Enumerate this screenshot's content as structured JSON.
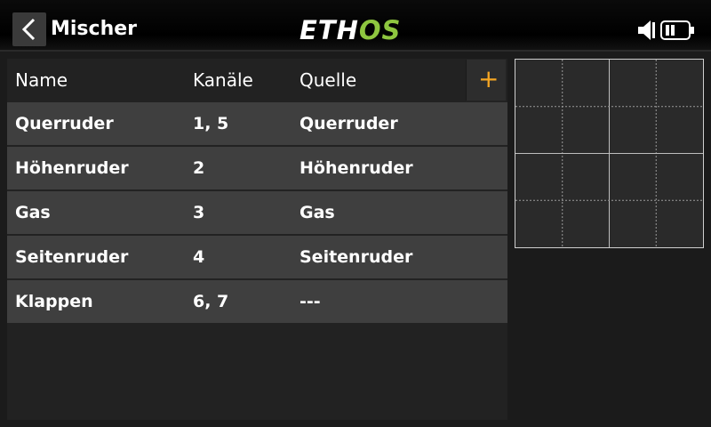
{
  "header": {
    "title": "Mischer",
    "logo_left": "ETH",
    "logo_right": "OS"
  },
  "colors": {
    "logo_accent": "#8ec63f",
    "add_accent": "#f5a623",
    "row_bg": "#3f3f3f"
  },
  "table": {
    "columns": [
      "Name",
      "Kanäle",
      "Quelle"
    ],
    "add_label": "+",
    "rows": [
      {
        "name": "Querruder",
        "channels": "1, 5",
        "source": "Querruder"
      },
      {
        "name": "Höhenruder",
        "channels": "2",
        "source": "Höhenruder"
      },
      {
        "name": "Gas",
        "channels": "3",
        "source": "Gas"
      },
      {
        "name": "Seitenruder",
        "channels": "4",
        "source": "Seitenruder"
      },
      {
        "name": "Klappen",
        "channels": "6, 7",
        "source": "---"
      }
    ]
  },
  "icons": {
    "back": "chevron-left-icon",
    "speaker": "speaker-icon",
    "battery": "battery-icon"
  }
}
